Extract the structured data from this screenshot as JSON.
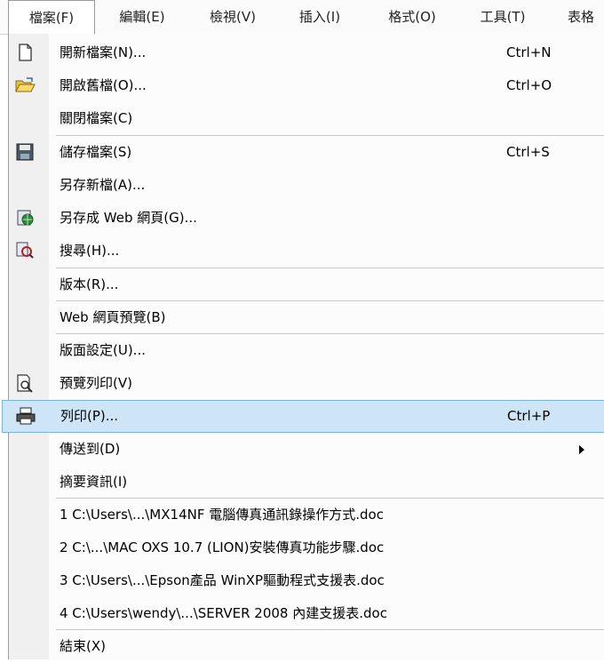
{
  "menubar": [
    {
      "label": "檔案(F)",
      "active": true
    },
    {
      "label": "編輯(E)"
    },
    {
      "label": "檢視(V)"
    },
    {
      "label": "插入(I)"
    },
    {
      "label": "格式(O)"
    },
    {
      "label": "工具(T)"
    },
    {
      "label": "表格"
    }
  ],
  "menu": {
    "items": [
      {
        "id": "new",
        "label": "開新檔案(N)...",
        "shortcut": "Ctrl+N",
        "icon": "new-document-icon"
      },
      {
        "id": "open",
        "label": "開啟舊檔(O)...",
        "shortcut": "Ctrl+O",
        "icon": "open-folder-icon"
      },
      {
        "id": "close",
        "label": "關閉檔案(C)"
      },
      {
        "id": "save",
        "label": "儲存檔案(S)",
        "shortcut": "Ctrl+S",
        "icon": "floppy-disk-icon"
      },
      {
        "id": "saveas",
        "label": "另存新檔(A)..."
      },
      {
        "id": "saveweb",
        "label": "另存成 Web 網頁(G)...",
        "icon": "web-page-icon"
      },
      {
        "id": "search",
        "label": "搜尋(H)...",
        "icon": "search-document-icon"
      },
      {
        "id": "versions",
        "label": "版本(R)..."
      },
      {
        "id": "webpreview",
        "label": "Web 網頁預覽(B)"
      },
      {
        "id": "pagesetup",
        "label": "版面設定(U)..."
      },
      {
        "id": "printpreview",
        "label": "預覽列印(V)",
        "icon": "print-preview-icon"
      },
      {
        "id": "print",
        "label": "列印(P)...",
        "shortcut": "Ctrl+P",
        "icon": "printer-icon",
        "highlighted": true
      },
      {
        "id": "sendto",
        "label": "傳送到(D)",
        "submenu": true
      },
      {
        "id": "properties",
        "label": "摘要資訊(I)"
      },
      {
        "id": "recent1",
        "label": "1 C:\\Users\\...\\MX14NF 電腦傳真通訊錄操作方式.doc"
      },
      {
        "id": "recent2",
        "label": "2 C:\\...\\MAC OXS 10.7 (LION)安裝傳真功能步驟.doc"
      },
      {
        "id": "recent3",
        "label": "3 C:\\Users\\...\\Epson產品 WinXP驅動程式支援表.doc"
      },
      {
        "id": "recent4",
        "label": "4 C:\\Users\\wendy\\...\\SERVER 2008 內建支援表.doc"
      },
      {
        "id": "exit",
        "label": "結束(X)"
      }
    ]
  },
  "colors": {
    "highlight_bg": "#cde5f7",
    "highlight_border": "#7ab2e0",
    "icon_column": "#f0f0f0"
  }
}
